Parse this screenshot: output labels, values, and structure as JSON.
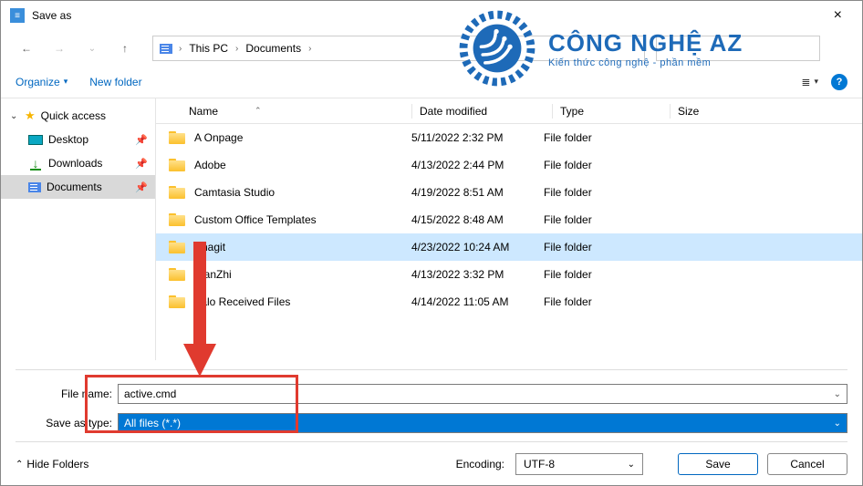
{
  "window": {
    "title": "Save as",
    "close_label": "×"
  },
  "nav": {
    "breadcrumb": {
      "root": "This PC",
      "folder": "Documents"
    }
  },
  "toolbar": {
    "organize": "Organize",
    "new_folder": "New folder"
  },
  "sidebar": {
    "quick_access": "Quick access",
    "desktop": "Desktop",
    "downloads": "Downloads",
    "documents": "Documents"
  },
  "columns": {
    "name": "Name",
    "date": "Date modified",
    "type": "Type",
    "size": "Size"
  },
  "rows": [
    {
      "name": "A Onpage",
      "date": "5/11/2022 2:32 PM",
      "type": "File folder"
    },
    {
      "name": "Adobe",
      "date": "4/13/2022 2:44 PM",
      "type": "File folder"
    },
    {
      "name": "Camtasia Studio",
      "date": "4/19/2022 8:51 AM",
      "type": "File folder"
    },
    {
      "name": "Custom Office Templates",
      "date": "4/15/2022 8:48 AM",
      "type": "File folder"
    },
    {
      "name": "Snagit",
      "date": "4/23/2022 10:24 AM",
      "type": "File folder",
      "selected": true
    },
    {
      "name": "XianZhi",
      "date": "4/13/2022 3:32 PM",
      "type": "File folder"
    },
    {
      "name": "Zalo Received Files",
      "date": "4/14/2022 11:05 AM",
      "type": "File folder"
    }
  ],
  "form": {
    "file_name_label": "File name:",
    "file_name_value": "active.cmd",
    "type_label": "Save as type:",
    "type_value": "All files  (*.*)"
  },
  "footer": {
    "hide_folders": "Hide Folders",
    "encoding_label": "Encoding:",
    "encoding_value": "UTF-8",
    "save": "Save",
    "cancel": "Cancel"
  },
  "watermark": {
    "title": "CÔNG NGHỆ AZ",
    "subtitle": "Kiến thức công nghệ - phần mềm"
  }
}
